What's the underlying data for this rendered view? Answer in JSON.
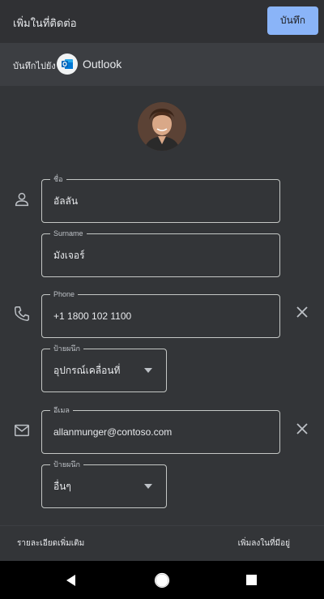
{
  "header": {
    "title": "เพิ่มในที่ติดต่อ",
    "save_label": "บันทึก"
  },
  "save_to": {
    "label": "บันทึกไปยัง",
    "account": "Outlook"
  },
  "fields": {
    "first_name": {
      "label": "ชื่อ",
      "value": "อัลลัน"
    },
    "surname": {
      "label": "Surname",
      "value": "มังเจอร์"
    },
    "phone": {
      "label": "Phone",
      "value": "+1 1800 102 1100"
    },
    "phone_type": {
      "label": "ป้ายผนึก",
      "value": "อุปกรณ์เคลื่อนที่"
    },
    "email": {
      "label": "อีเมล",
      "value": "allanmunger@contoso.com"
    },
    "email_type": {
      "label": "ป้ายผนึก",
      "value": "อื่นๆ"
    }
  },
  "footer": {
    "more_details": "รายละเอียดเพิ่มเติม",
    "add_to_device": "เพิ่มลงในที่มีอยู่"
  },
  "colors": {
    "accent": "#8ab4f8",
    "background": "#333538",
    "nav_bar": "#000000"
  },
  "icons": [
    "person-icon",
    "phone-icon",
    "email-icon",
    "close-icon",
    "chevron-down-icon",
    "outlook-icon",
    "back-icon",
    "home-icon",
    "recents-icon"
  ]
}
